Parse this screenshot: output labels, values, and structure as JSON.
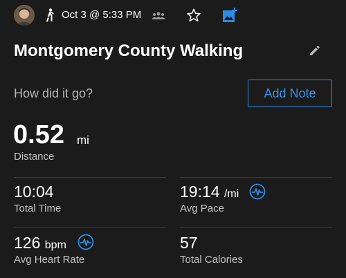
{
  "header": {
    "date": "Oct 3 @ 5:33 PM",
    "activity_icon": "walking-icon",
    "group_icon": "group-icon",
    "star_icon": "star-icon",
    "photo_icon": "add-photo-icon"
  },
  "activity": {
    "title": "Montgomery County Walking",
    "prompt": "How did it go?",
    "add_note_label": "Add Note"
  },
  "distance": {
    "value": "0.52",
    "unit": "mi",
    "label": "Distance"
  },
  "stats": {
    "total_time": {
      "value": "10:04",
      "label": "Total Time"
    },
    "avg_pace": {
      "value": "19:14",
      "unit": "/mi",
      "label": "Avg Pace"
    },
    "avg_heart_rate": {
      "value": "126",
      "unit": "bpm",
      "label": "Avg Heart Rate"
    },
    "total_calories": {
      "value": "57",
      "label": "Total Calories"
    }
  },
  "colors": {
    "background": "#1b1b1b",
    "accent": "#2f8ae2",
    "label": "#c4c4c4"
  }
}
